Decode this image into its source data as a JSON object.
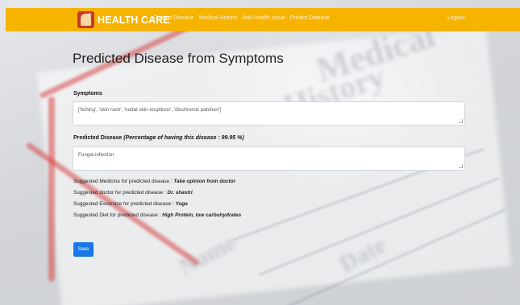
{
  "navbar": {
    "brand": "HEALTH CARE",
    "links": [
      "Current Disease",
      "Medical History",
      "Add Health Issue",
      "Predict Disease"
    ],
    "logout": "Logout",
    "color": "#f6b300"
  },
  "main": {
    "title": "Predicted Disease from Symptoms",
    "symptoms_label": "Symptoms",
    "symptoms_value": "['itching', 'skin rash', 'nodal skin eruptions', 'dischromic patches']",
    "predicted_label": "Predicted Disease",
    "predicted_percentage_text": "(Percentage of having this disease : 99.95 %)",
    "predicted_value": "Fungal infection",
    "suggestions": [
      {
        "prefix": "Suggested Medicine for predicted disease : ",
        "value": "Take opinion from doctor"
      },
      {
        "prefix": "Suggested doctor for predicted disease : ",
        "value": "Dr. shastri"
      },
      {
        "prefix": "Suggested Excersize for predicted disease : ",
        "value": "Yoga"
      },
      {
        "prefix": "Suggested Diet for predicted disease : ",
        "value": "High Protein, low carbohydrates"
      }
    ],
    "save_label": "Save",
    "save_color": "#1977e8"
  }
}
